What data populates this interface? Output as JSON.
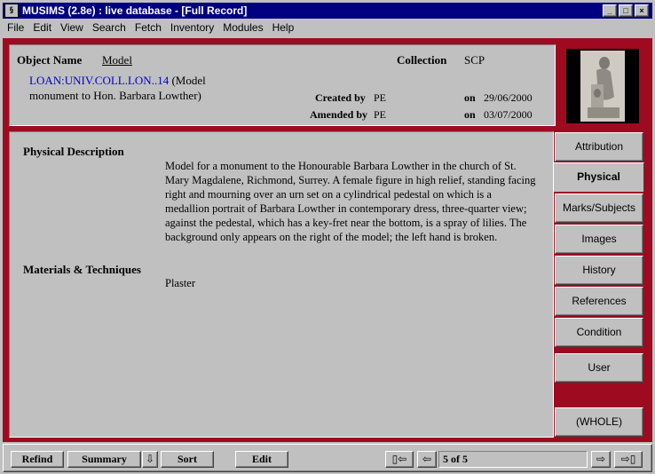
{
  "window": {
    "icon_label": "§",
    "title": "MUSIMS (2.8e) : live database - [Full Record]",
    "min_glyph": "_",
    "max_glyph": "□",
    "close_glyph": "×"
  },
  "menu": [
    "File",
    "Edit",
    "View",
    "Search",
    "Fetch",
    "Inventory",
    "Modules",
    "Help"
  ],
  "record": {
    "object_name_label": "Object Name",
    "object_name_value": "Model",
    "collection_label": "Collection",
    "collection_value": "SCP",
    "accession_link": "LOAN:UNIV.COLL.LON..14",
    "accession_desc_1": " (Model",
    "accession_desc_2": "monument to Hon. Barbara Lowther)",
    "created_label": "Created by",
    "created_by": "PE",
    "created_on_label": "on",
    "created_on": "29/06/2000",
    "amended_label": "Amended by",
    "amended_by": "PE",
    "amended_on_label": "on",
    "amended_on": "03/07/2000"
  },
  "physical": {
    "description_label": "Physical Description",
    "description_text": "Model for a monument to the Honourable Barbara Lowther in the church of St. Mary Magdalene, Richmond, Surrey. A female figure in high relief, standing facing right and mourning over an urn set on a cylindrical pedestal on which is a medallion portrait of Barbara Lowther in contemporary dress, three-quarter view; against the pedestal, which has a key-fret near the bottom, is a spray of lilies. The background only appears on the right of the model; the left hand is broken.",
    "materials_label": "Materials & Techniques",
    "materials_value": "Plaster"
  },
  "tabs": {
    "attribution": "Attribution",
    "physical": "Physical",
    "marks": "Marks/Subjects",
    "images": "Images",
    "history": "History",
    "references": "References",
    "condition": "Condition",
    "user": "User",
    "whole": "(WHOLE)"
  },
  "toolbar": {
    "refind": "Refind",
    "summary": "Summary",
    "summary_arrow": "⇩",
    "sort": "Sort",
    "edit": "Edit",
    "first": "▯⇦",
    "prev": "⇦",
    "record_counter": "5 of 5",
    "next": "⇨",
    "last": "⇨▯"
  },
  "colors": {
    "frame": "#9e0b20",
    "titlebar": "#000080",
    "link": "#0000cc"
  }
}
